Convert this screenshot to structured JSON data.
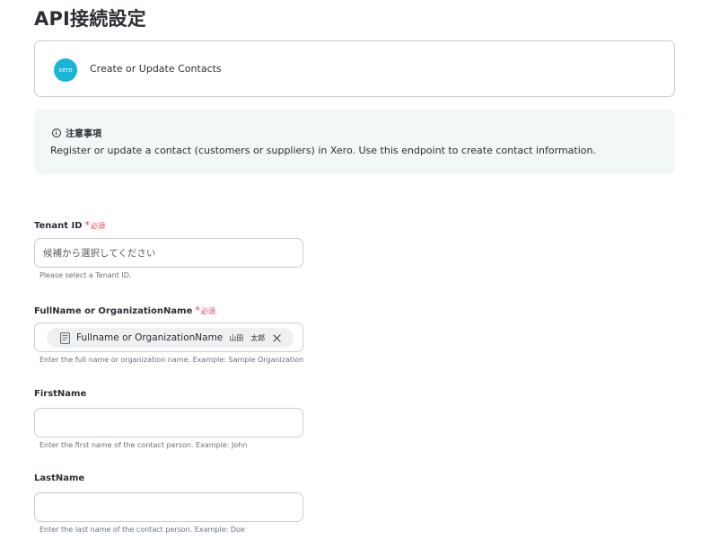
{
  "page": {
    "title": "API接続設定"
  },
  "app_card": {
    "logo_text": "xero",
    "action_name": "Create or Update Contacts"
  },
  "notice": {
    "title": "注意事項",
    "body": "Register or update a contact (customers or suppliers) in Xero. Use this endpoint to create contact information."
  },
  "fields": {
    "tenant_id": {
      "label": "Tenant ID",
      "required_mark": "*",
      "required_text": "必須",
      "placeholder": "候補から選択してください",
      "hint": "Please select a Tenant ID."
    },
    "fullname": {
      "label": "FullName or OrganizationName",
      "required_mark": "*",
      "required_text": "必須",
      "chip_label": "Fullname or OrganizationName",
      "chip_value": "山田　太郎",
      "hint": "Enter the full name or organization name. Example: Sample Organization"
    },
    "first_name": {
      "label": "FirstName",
      "value": "",
      "hint": "Enter the first name of the contact person. Example: John"
    },
    "last_name": {
      "label": "LastName",
      "value": "",
      "hint": "Enter the last name of the contact person. Example: Doe"
    }
  },
  "colors": {
    "accent_required": "#e5405a",
    "xero_brand": "#1ab4d7",
    "notice_bg": "#f1f8f7"
  },
  "icons": [
    "xero-logo",
    "info-icon",
    "document-icon",
    "close-icon"
  ]
}
